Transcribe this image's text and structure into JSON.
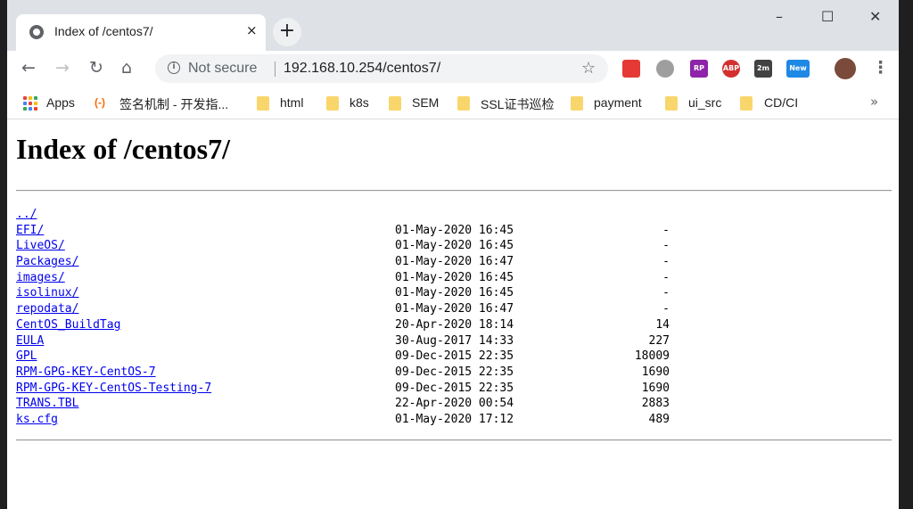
{
  "tab": {
    "title": "Index of /centos7/",
    "close_icon": "×",
    "new_tab_icon": "+"
  },
  "window_controls": {
    "minimize": "–",
    "maximize": "☐",
    "close": "✕"
  },
  "toolbar": {
    "back_icon": "←",
    "forward_icon": "→",
    "reload_icon": "↻",
    "home_icon": "⌂",
    "security_label": "Not secure",
    "url": "192.168.10.254/centos7/",
    "star_icon": "☆",
    "menu_icon": "⋮",
    "extensions": [
      {
        "name": "extension-1",
        "text": "",
        "color": "#e53935"
      },
      {
        "name": "extension-2",
        "text": "",
        "color": "#9e9e9e"
      },
      {
        "name": "extension-rp",
        "text": "RP",
        "color": "#8e24aa"
      },
      {
        "name": "extension-abp",
        "text": "ABP",
        "color": "#d32f2f"
      },
      {
        "name": "extension-2m",
        "text": "2m",
        "color": "#424242"
      },
      {
        "name": "extension-new",
        "text": "New",
        "color": "#1e88e5"
      }
    ]
  },
  "bookmarks": {
    "items": [
      {
        "label": "Apps",
        "icon": "apps-grid"
      },
      {
        "label": "签名机制 - 开发指...",
        "icon": "alibaba-cloud"
      },
      {
        "label": "html",
        "icon": "folder"
      },
      {
        "label": "k8s",
        "icon": "folder"
      },
      {
        "label": "SEM",
        "icon": "folder"
      },
      {
        "label": "SSL证书巡检",
        "icon": "folder"
      },
      {
        "label": "payment",
        "icon": "folder"
      },
      {
        "label": "ui_src",
        "icon": "folder"
      },
      {
        "label": "CD/CI",
        "icon": "folder"
      }
    ],
    "more_icon": "»"
  },
  "page": {
    "heading": "Index of /centos7/",
    "entries": [
      {
        "name": "../",
        "date": "",
        "size": ""
      },
      {
        "name": "EFI/",
        "date": "01-May-2020 16:45",
        "size": "-"
      },
      {
        "name": "LiveOS/",
        "date": "01-May-2020 16:45",
        "size": "-"
      },
      {
        "name": "Packages/",
        "date": "01-May-2020 16:47",
        "size": "-"
      },
      {
        "name": "images/",
        "date": "01-May-2020 16:45",
        "size": "-"
      },
      {
        "name": "isolinux/",
        "date": "01-May-2020 16:45",
        "size": "-"
      },
      {
        "name": "repodata/",
        "date": "01-May-2020 16:47",
        "size": "-"
      },
      {
        "name": "CentOS_BuildTag",
        "date": "20-Apr-2020 18:14",
        "size": "14"
      },
      {
        "name": "EULA",
        "date": "30-Aug-2017 14:33",
        "size": "227"
      },
      {
        "name": "GPL",
        "date": "09-Dec-2015 22:35",
        "size": "18009"
      },
      {
        "name": "RPM-GPG-KEY-CentOS-7",
        "date": "09-Dec-2015 22:35",
        "size": "1690"
      },
      {
        "name": "RPM-GPG-KEY-CentOS-Testing-7",
        "date": "09-Dec-2015 22:35",
        "size": "1690"
      },
      {
        "name": "TRANS.TBL",
        "date": "22-Apr-2020 00:54",
        "size": "2883"
      },
      {
        "name": "ks.cfg",
        "date": "01-May-2020 17:12",
        "size": "489"
      }
    ]
  }
}
